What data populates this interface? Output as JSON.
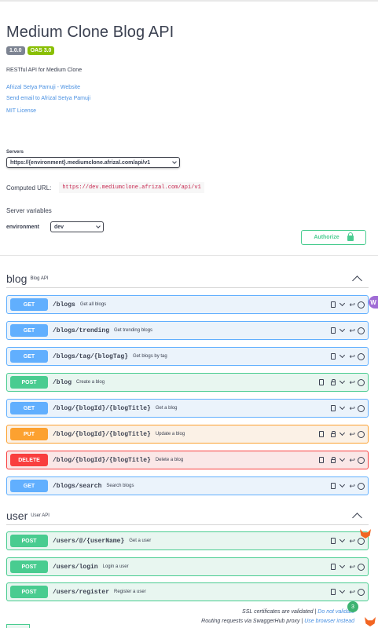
{
  "info": {
    "title": "Medium Clone Blog API",
    "version": "1.0.0",
    "oas": "OAS 3.0",
    "description": "RESTful API for Medium Clone",
    "links": [
      "Afrizal Setya Pamuji - Website",
      "Send email to Afrizal Setya Pamuji",
      "MIT License"
    ]
  },
  "servers": {
    "label": "Servers",
    "selected": "https://{environment}.mediumclone.afrizal.com/api/v1",
    "computed_label": "Computed URL:",
    "computed_url": "https://dev.mediumclone.afrizal.com/api/v1",
    "variables_label": "Server variables",
    "env_label": "environment",
    "env_value": "dev"
  },
  "authorize": {
    "label": "Authorize"
  },
  "tags": [
    {
      "name": "blog",
      "description": "Blog API"
    },
    {
      "name": "user",
      "description": "User API"
    }
  ],
  "operations": [
    {
      "method": "GET",
      "path": "/blogs",
      "summary": "Get all blogs"
    },
    {
      "method": "GET",
      "path": "/blogs/trending",
      "summary": "Get trending blogs"
    },
    {
      "method": "GET",
      "path": "/blogs/tag/{blogTag}",
      "summary": "Get blogs by tag"
    },
    {
      "method": "POST",
      "path": "/blog",
      "summary": "Create a blog"
    },
    {
      "method": "GET",
      "path": "/blog/{blogId}/{blogTitle}",
      "summary": "Get a blog"
    },
    {
      "method": "PUT",
      "path": "/blog/{blogId}/{blogTitle}",
      "summary": "Update a blog"
    },
    {
      "method": "DELETE",
      "path": "/blog/{blogId}/{blogTitle}",
      "summary": "Delete a blog"
    },
    {
      "method": "GET",
      "path": "/blogs/search",
      "summary": "Search blogs"
    },
    {
      "method": "POST",
      "path": "/users/@/{userName}",
      "summary": "Get a user"
    },
    {
      "method": "POST",
      "path": "/users/login",
      "summary": "Login a user"
    },
    {
      "method": "POST",
      "path": "/users/register",
      "summary": "Register a user"
    }
  ],
  "footer": {
    "ssl_text": "SSL certificates are validated |",
    "ssl_link": "Do not validate",
    "proxy_text": "Routing requests via SwaggerHub proxy |",
    "proxy_link": "Use browser instead"
  },
  "widgets": {
    "w_label": "W",
    "notif_count": "3"
  },
  "colors": {
    "get": "#61affe",
    "post": "#49cc90",
    "put": "#fca130",
    "delete": "#f93e3e"
  }
}
